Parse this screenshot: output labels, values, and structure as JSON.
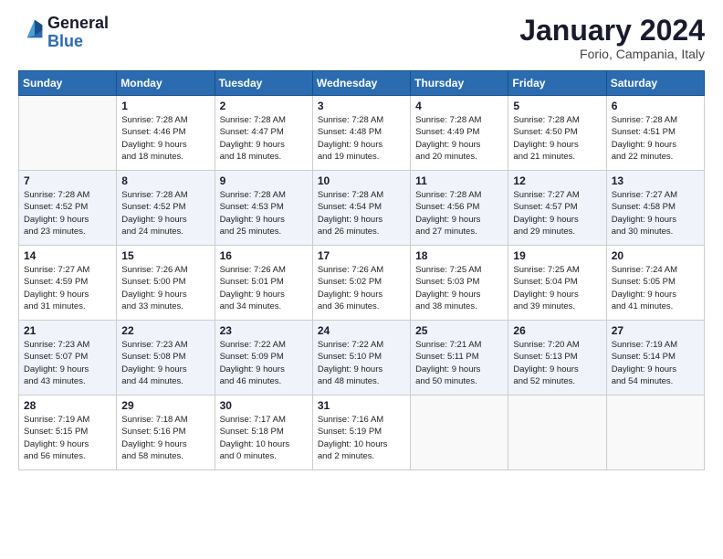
{
  "header": {
    "logo_general": "General",
    "logo_blue": "Blue",
    "month_title": "January 2024",
    "location": "Forio, Campania, Italy"
  },
  "days_of_week": [
    "Sunday",
    "Monday",
    "Tuesday",
    "Wednesday",
    "Thursday",
    "Friday",
    "Saturday"
  ],
  "weeks": [
    [
      {
        "day": "",
        "info": ""
      },
      {
        "day": "1",
        "info": "Sunrise: 7:28 AM\nSunset: 4:46 PM\nDaylight: 9 hours\nand 18 minutes."
      },
      {
        "day": "2",
        "info": "Sunrise: 7:28 AM\nSunset: 4:47 PM\nDaylight: 9 hours\nand 18 minutes."
      },
      {
        "day": "3",
        "info": "Sunrise: 7:28 AM\nSunset: 4:48 PM\nDaylight: 9 hours\nand 19 minutes."
      },
      {
        "day": "4",
        "info": "Sunrise: 7:28 AM\nSunset: 4:49 PM\nDaylight: 9 hours\nand 20 minutes."
      },
      {
        "day": "5",
        "info": "Sunrise: 7:28 AM\nSunset: 4:50 PM\nDaylight: 9 hours\nand 21 minutes."
      },
      {
        "day": "6",
        "info": "Sunrise: 7:28 AM\nSunset: 4:51 PM\nDaylight: 9 hours\nand 22 minutes."
      }
    ],
    [
      {
        "day": "7",
        "info": "Sunrise: 7:28 AM\nSunset: 4:52 PM\nDaylight: 9 hours\nand 23 minutes."
      },
      {
        "day": "8",
        "info": "Sunrise: 7:28 AM\nSunset: 4:52 PM\nDaylight: 9 hours\nand 24 minutes."
      },
      {
        "day": "9",
        "info": "Sunrise: 7:28 AM\nSunset: 4:53 PM\nDaylight: 9 hours\nand 25 minutes."
      },
      {
        "day": "10",
        "info": "Sunrise: 7:28 AM\nSunset: 4:54 PM\nDaylight: 9 hours\nand 26 minutes."
      },
      {
        "day": "11",
        "info": "Sunrise: 7:28 AM\nSunset: 4:56 PM\nDaylight: 9 hours\nand 27 minutes."
      },
      {
        "day": "12",
        "info": "Sunrise: 7:27 AM\nSunset: 4:57 PM\nDaylight: 9 hours\nand 29 minutes."
      },
      {
        "day": "13",
        "info": "Sunrise: 7:27 AM\nSunset: 4:58 PM\nDaylight: 9 hours\nand 30 minutes."
      }
    ],
    [
      {
        "day": "14",
        "info": "Sunrise: 7:27 AM\nSunset: 4:59 PM\nDaylight: 9 hours\nand 31 minutes."
      },
      {
        "day": "15",
        "info": "Sunrise: 7:26 AM\nSunset: 5:00 PM\nDaylight: 9 hours\nand 33 minutes."
      },
      {
        "day": "16",
        "info": "Sunrise: 7:26 AM\nSunset: 5:01 PM\nDaylight: 9 hours\nand 34 minutes."
      },
      {
        "day": "17",
        "info": "Sunrise: 7:26 AM\nSunset: 5:02 PM\nDaylight: 9 hours\nand 36 minutes."
      },
      {
        "day": "18",
        "info": "Sunrise: 7:25 AM\nSunset: 5:03 PM\nDaylight: 9 hours\nand 38 minutes."
      },
      {
        "day": "19",
        "info": "Sunrise: 7:25 AM\nSunset: 5:04 PM\nDaylight: 9 hours\nand 39 minutes."
      },
      {
        "day": "20",
        "info": "Sunrise: 7:24 AM\nSunset: 5:05 PM\nDaylight: 9 hours\nand 41 minutes."
      }
    ],
    [
      {
        "day": "21",
        "info": "Sunrise: 7:23 AM\nSunset: 5:07 PM\nDaylight: 9 hours\nand 43 minutes."
      },
      {
        "day": "22",
        "info": "Sunrise: 7:23 AM\nSunset: 5:08 PM\nDaylight: 9 hours\nand 44 minutes."
      },
      {
        "day": "23",
        "info": "Sunrise: 7:22 AM\nSunset: 5:09 PM\nDaylight: 9 hours\nand 46 minutes."
      },
      {
        "day": "24",
        "info": "Sunrise: 7:22 AM\nSunset: 5:10 PM\nDaylight: 9 hours\nand 48 minutes."
      },
      {
        "day": "25",
        "info": "Sunrise: 7:21 AM\nSunset: 5:11 PM\nDaylight: 9 hours\nand 50 minutes."
      },
      {
        "day": "26",
        "info": "Sunrise: 7:20 AM\nSunset: 5:13 PM\nDaylight: 9 hours\nand 52 minutes."
      },
      {
        "day": "27",
        "info": "Sunrise: 7:19 AM\nSunset: 5:14 PM\nDaylight: 9 hours\nand 54 minutes."
      }
    ],
    [
      {
        "day": "28",
        "info": "Sunrise: 7:19 AM\nSunset: 5:15 PM\nDaylight: 9 hours\nand 56 minutes."
      },
      {
        "day": "29",
        "info": "Sunrise: 7:18 AM\nSunset: 5:16 PM\nDaylight: 9 hours\nand 58 minutes."
      },
      {
        "day": "30",
        "info": "Sunrise: 7:17 AM\nSunset: 5:18 PM\nDaylight: 10 hours\nand 0 minutes."
      },
      {
        "day": "31",
        "info": "Sunrise: 7:16 AM\nSunset: 5:19 PM\nDaylight: 10 hours\nand 2 minutes."
      },
      {
        "day": "",
        "info": ""
      },
      {
        "day": "",
        "info": ""
      },
      {
        "day": "",
        "info": ""
      }
    ]
  ]
}
